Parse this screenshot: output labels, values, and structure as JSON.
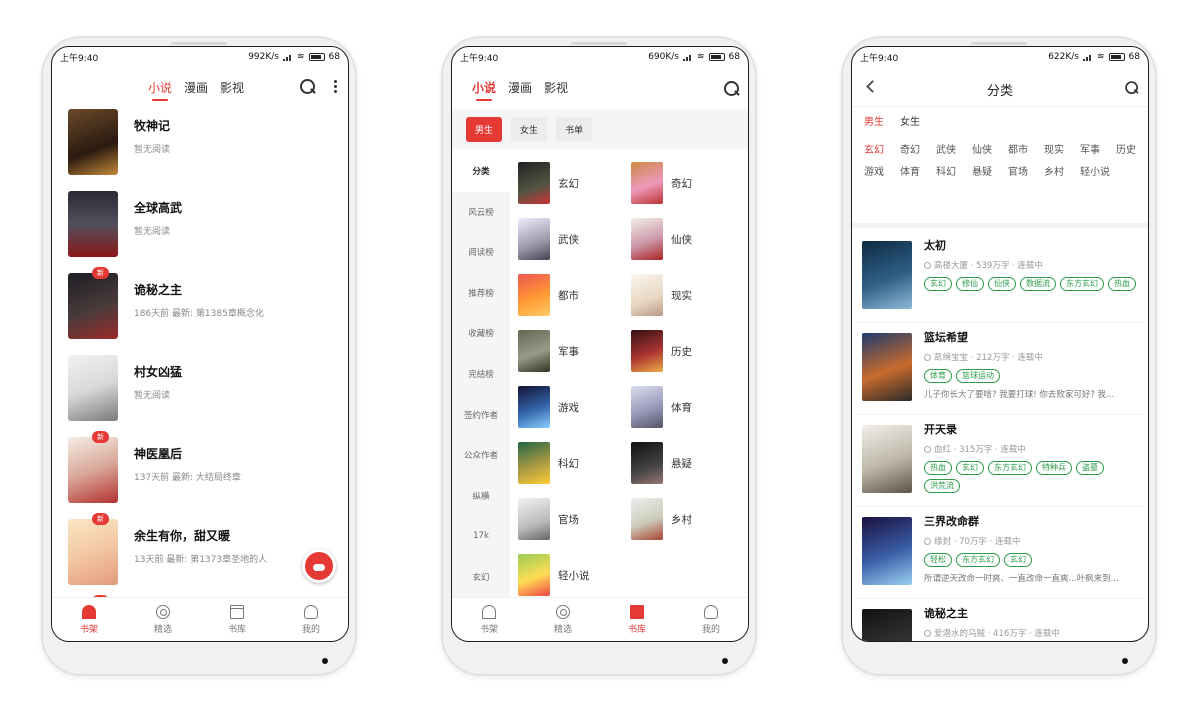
{
  "colors": {
    "accent": "#e53935",
    "tag_green": "#2e9c4b"
  },
  "screen1": {
    "status": {
      "time": "上午9:40",
      "speed": "992K/s",
      "battery": "68"
    },
    "tabs": [
      {
        "label": "小说",
        "active": true
      },
      {
        "label": "漫画"
      },
      {
        "label": "影视"
      }
    ],
    "books": [
      {
        "title": "牧神记",
        "sub": "暂无阅读",
        "new": false
      },
      {
        "title": "全球高武",
        "sub": "暂无阅读",
        "new": false
      },
      {
        "title": "诡秘之主",
        "sub": "186天前 最新: 第1385章概念化",
        "new": true,
        "badge": "新"
      },
      {
        "title": "村女凶猛",
        "sub": "暂无阅读",
        "new": false
      },
      {
        "title": "神医凰后",
        "sub": "137天前 最新: 大结局终章",
        "new": true,
        "badge": "新"
      },
      {
        "title": "余生有你，甜又暖",
        "sub": "13天前 最新: 第1373章圣地的人",
        "new": true,
        "badge": "新"
      }
    ],
    "last_badge": "新",
    "nav": [
      {
        "label": "书架",
        "icon": "home-icon",
        "active": true
      },
      {
        "label": "精选",
        "icon": "compass-icon"
      },
      {
        "label": "书库",
        "icon": "library-icon"
      },
      {
        "label": "我的",
        "icon": "user-icon"
      }
    ]
  },
  "screen2": {
    "status": {
      "time": "上午9:40",
      "speed": "690K/s",
      "battery": "68"
    },
    "tabs": [
      {
        "label": "小说",
        "active": true
      },
      {
        "label": "漫画"
      },
      {
        "label": "影视"
      }
    ],
    "chips": [
      {
        "label": "男生",
        "active": true
      },
      {
        "label": "女生"
      },
      {
        "label": "书单"
      }
    ],
    "side": [
      {
        "label": "分类",
        "active": true
      },
      {
        "label": "风云榜"
      },
      {
        "label": "阅读榜"
      },
      {
        "label": "推荐榜"
      },
      {
        "label": "收藏榜"
      },
      {
        "label": "完结榜"
      },
      {
        "label": "签约作者"
      },
      {
        "label": "公众作者"
      },
      {
        "label": "纵横"
      },
      {
        "label": "17k"
      },
      {
        "label": "玄幻"
      }
    ],
    "categories": [
      "玄幻",
      "奇幻",
      "武侠",
      "仙侠",
      "都市",
      "现实",
      "军事",
      "历史",
      "游戏",
      "体育",
      "科幻",
      "悬疑",
      "官场",
      "乡村",
      "轻小说"
    ],
    "nav": [
      {
        "label": "书架",
        "icon": "home-icon"
      },
      {
        "label": "精选",
        "icon": "compass-icon"
      },
      {
        "label": "书库",
        "icon": "library-icon",
        "active": true
      },
      {
        "label": "我的",
        "icon": "user-icon"
      }
    ]
  },
  "screen3": {
    "status": {
      "time": "上午9:40",
      "speed": "622K/s",
      "battery": "68"
    },
    "title": "分类",
    "gender": [
      {
        "label": "男生",
        "active": true
      },
      {
        "label": "女生"
      }
    ],
    "subcats": [
      {
        "label": "玄幻",
        "active": true
      },
      {
        "label": "奇幻"
      },
      {
        "label": "武侠"
      },
      {
        "label": "仙侠"
      },
      {
        "label": "都市"
      },
      {
        "label": "现实"
      },
      {
        "label": "军事"
      },
      {
        "label": "历史"
      },
      {
        "label": "游戏"
      },
      {
        "label": "体育"
      },
      {
        "label": "科幻"
      },
      {
        "label": "悬疑"
      },
      {
        "label": "官场"
      },
      {
        "label": "乡村"
      },
      {
        "label": "轻小说"
      }
    ],
    "books": [
      {
        "name": "太初",
        "meta": "高楼大厦 · 539万字 · 连载中",
        "tags": [
          "玄幻",
          "修仙",
          "仙侠",
          "数据流",
          "东方玄幻",
          "热血"
        ],
        "desc": ""
      },
      {
        "name": "篮坛希望",
        "meta": "凯绵宝宝 · 212万字 · 连载中",
        "tags": [
          "体育",
          "篮球运动"
        ],
        "desc": "儿子你长大了要啥? 我要打球! 你去败家可好? 我..."
      },
      {
        "name": "开天录",
        "meta": "血红 · 315万字 · 连载中",
        "tags": [
          "热血",
          "玄幻",
          "东方玄幻",
          "特种兵",
          "盗墓",
          "洪荒流"
        ],
        "desc": ""
      },
      {
        "name": "三界改命群",
        "meta": "缘封 · 70万字 · 连载中",
        "tags": [
          "轻松",
          "东方玄幻",
          "玄幻"
        ],
        "desc": "所谓逆天改命一时爽、一直改命一直爽...叶枫来到..."
      },
      {
        "name": "诡秘之主",
        "meta": "爱潜水的乌贼 · 416万字 · 连载中",
        "tags": [],
        "desc": ""
      }
    ]
  }
}
